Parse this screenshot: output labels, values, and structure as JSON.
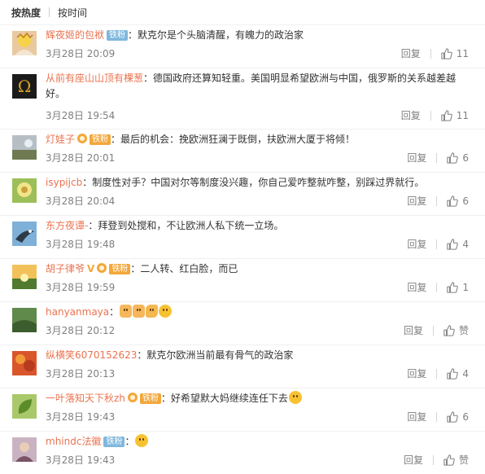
{
  "sort": {
    "hot": "按热度",
    "time": "按时间"
  },
  "reply_label": "回复",
  "colors": {
    "username": "#eb7350",
    "badge_fan": "#7fb7dd",
    "badge_iron": "#f3a73a",
    "meta": "#808080"
  },
  "comments": [
    {
      "user": "辉夜姬的包袱",
      "badge": "铁粉",
      "text": "：默克尔是个头脑清醒，有魄力的政治家",
      "time": "3月28日 20:09",
      "likes": "11"
    },
    {
      "user": "从前有座山山顶有棵葱",
      "badge": "",
      "text": "：德国政府还算知轻重。美国明显希望欧洲与中国，俄罗斯的关系越差越好。",
      "time": "3月28日 19:54",
      "likes": "11"
    },
    {
      "user": "灯娃子",
      "badge": "铁粉",
      "text": "：最后的机会：挽欧洲狂澜于既倒，扶欧洲大厦于将倾！",
      "time": "3月28日 20:01",
      "likes": "6"
    },
    {
      "user": "isypijcb",
      "badge": "",
      "text": "：制度性对手？中国对尔等制度没兴趣，你自己爱咋整就咋整，别踩过界就行。",
      "time": "3月28日 20:04",
      "likes": "6"
    },
    {
      "user": "东方夜谭-",
      "badge": "",
      "text": "：拜登到处搅和，不让欧洲人私下统一立场。",
      "time": "3月28日 19:48",
      "likes": "4"
    },
    {
      "user": "胡子律爷",
      "badge": "铁粉",
      "text": "：二人转、红白脸，而已",
      "time": "3月28日 19:59",
      "likes": "1"
    },
    {
      "user": "hanyanmaya",
      "badge": "",
      "text": "：",
      "time": "3月28日 20:12",
      "likes": "赞"
    },
    {
      "user": "纵横笑6070152623",
      "badge": "",
      "text": "：默克尔欧洲当前最有骨气的政治家",
      "time": "3月28日 20:13",
      "likes": "4"
    },
    {
      "user": "一叶落知天下秋zh",
      "badge": "铁粉",
      "text": "：好希望默大妈继续连任下去",
      "time": "3月28日 19:43",
      "likes": "6"
    },
    {
      "user": "mhindc法徽",
      "badge": "铁粉",
      "text": "：",
      "time": "3月28日 19:43",
      "likes": "赞"
    }
  ]
}
